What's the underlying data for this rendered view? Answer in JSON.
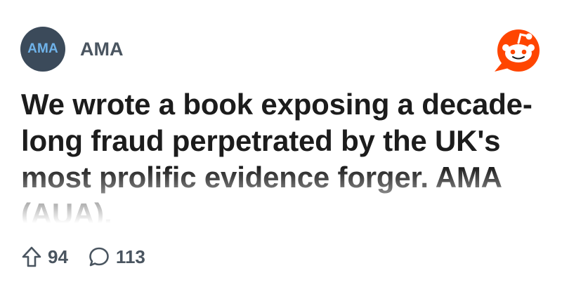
{
  "subreddit": {
    "avatar_text": "AMA",
    "name": "AMA"
  },
  "post": {
    "title": "We wrote a book exposing a decade-long fraud perpetrated by the UK's most prolific evidence forger. AMA (AUA).",
    "upvotes": "94",
    "comments": "113"
  },
  "icons": {
    "brand": "reddit-logo-icon",
    "upvote": "upvote-arrow-icon",
    "comment": "comment-bubble-icon"
  },
  "colors": {
    "brand_orange": "#ff4500",
    "avatar_bg": "#3b4a5a",
    "avatar_text": "#6fb3ea",
    "title_text": "#1c1c1c",
    "meta_text": "#4a5560"
  }
}
